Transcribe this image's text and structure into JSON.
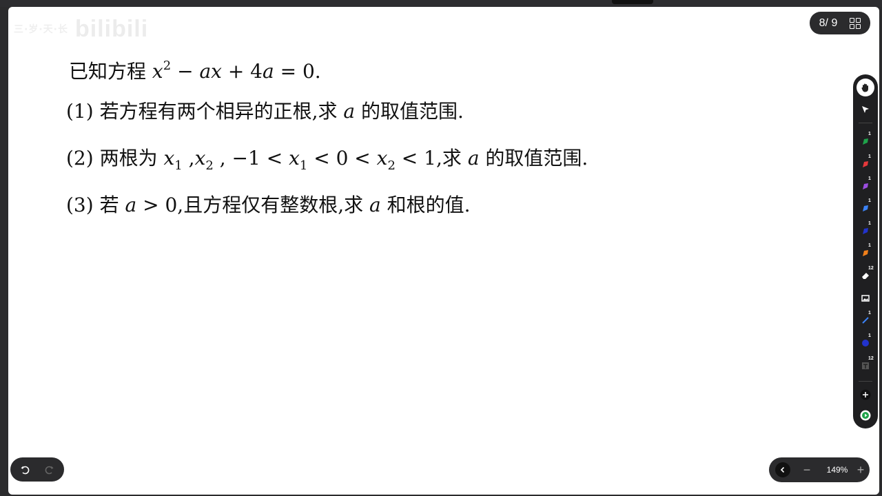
{
  "watermark": {
    "small": "三·岁·天·长",
    "logo": "bilibili"
  },
  "page_indicator": {
    "current": "8",
    "separator": "/",
    "total": "9"
  },
  "problem": {
    "line0": {
      "prefix": "已知方程",
      "eq": "x2 − ax + 4a = 0."
    },
    "line1": {
      "num": "(1)",
      "text_a": "若方程有两个相异的正根,求",
      "var": "a",
      "text_b": "的取值范围."
    },
    "line2": {
      "num": "(2)",
      "text_a": "两根为",
      "cond": "x1 , x2 , −1 < x1 < 0 < x2 < 1,",
      "text_b": "求",
      "var": "a",
      "text_c": "的取值范围."
    },
    "line3": {
      "num": "(3)",
      "text_a": "若",
      "cond": "a > 0,",
      "text_b": "且方程仅有整数根,求",
      "var": "a",
      "text_c": "和根的值."
    }
  },
  "toolbar": {
    "badges": {
      "pen_green": "1",
      "pen_red": "1",
      "pen_purple": "1",
      "pen_blue": "1",
      "pen_navy": "1",
      "pen_orange": "1",
      "eraser": "12",
      "line": "1",
      "circle": "1",
      "text": "12"
    },
    "colors": {
      "green": "#1fa34a",
      "red": "#e5383b",
      "purple": "#9b4de0",
      "blue": "#3b82f6",
      "navy": "#2233cc",
      "orange": "#f07f1a"
    }
  },
  "zoom": {
    "value": "149%",
    "minus": "−",
    "plus": "+"
  }
}
